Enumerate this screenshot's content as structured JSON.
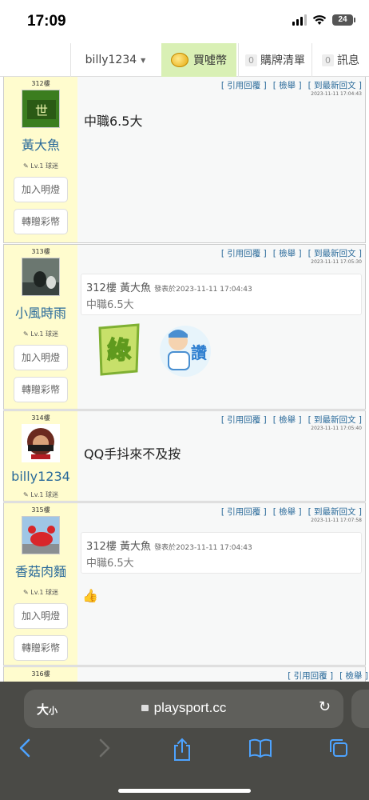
{
  "status_bar": {
    "time": "17:09",
    "battery": "24"
  },
  "nav": {
    "username": "billy1234",
    "buy_label": "買噓幣",
    "cart_count": "0",
    "cart_label": "購牌清單",
    "msg_count": "0",
    "msg_label": "訊息"
  },
  "actions": {
    "quote": "[ 引用回覆 ]",
    "report": "[ 檢舉 ]",
    "latest": "[ 到最新回文 ]"
  },
  "side_buttons": {
    "light": "加入明燈",
    "gift": "轉贈彩幣"
  },
  "posts": [
    {
      "floor": "312樓",
      "name": "黃大魚",
      "level": "Lv.1 球迷",
      "timestamp": "2023-11-11 17:04:43",
      "content": "中職6.5大"
    },
    {
      "floor": "313樓",
      "name": "小風時雨",
      "level": "Lv.1 球迷",
      "timestamp": "2023-11-11 17:05:30",
      "quote": {
        "header": "312樓 黃大魚",
        "meta": "發表於2023-11-11 17:04:43",
        "text": "中職6.5大"
      },
      "stickers": [
        "綠",
        "讚"
      ]
    },
    {
      "floor": "314樓",
      "name": "billy1234",
      "level": "Lv.1 球迷",
      "timestamp": "2023-11-11 17:05:40",
      "content": "QQ手抖來不及按"
    },
    {
      "floor": "315樓",
      "name": "香菇肉麵",
      "level": "Lv.1 球迷",
      "timestamp": "2023-11-11 17:07:58",
      "quote": {
        "header": "312樓 黃大魚",
        "meta": "發表於2023-11-11 17:04:43",
        "text": "中職6.5大"
      },
      "content": "👍"
    },
    {
      "floor": "316樓"
    }
  ],
  "safari": {
    "text_size": "大",
    "text_size_small": "小",
    "url": "playsport.cc"
  },
  "colors": {
    "sidebar_bg": "#fffcce",
    "link": "#2a6a9a",
    "buy_bg": "#d9f0b5",
    "safari_bg": "#4a4a46",
    "safari_icon": "#4da3ff"
  }
}
